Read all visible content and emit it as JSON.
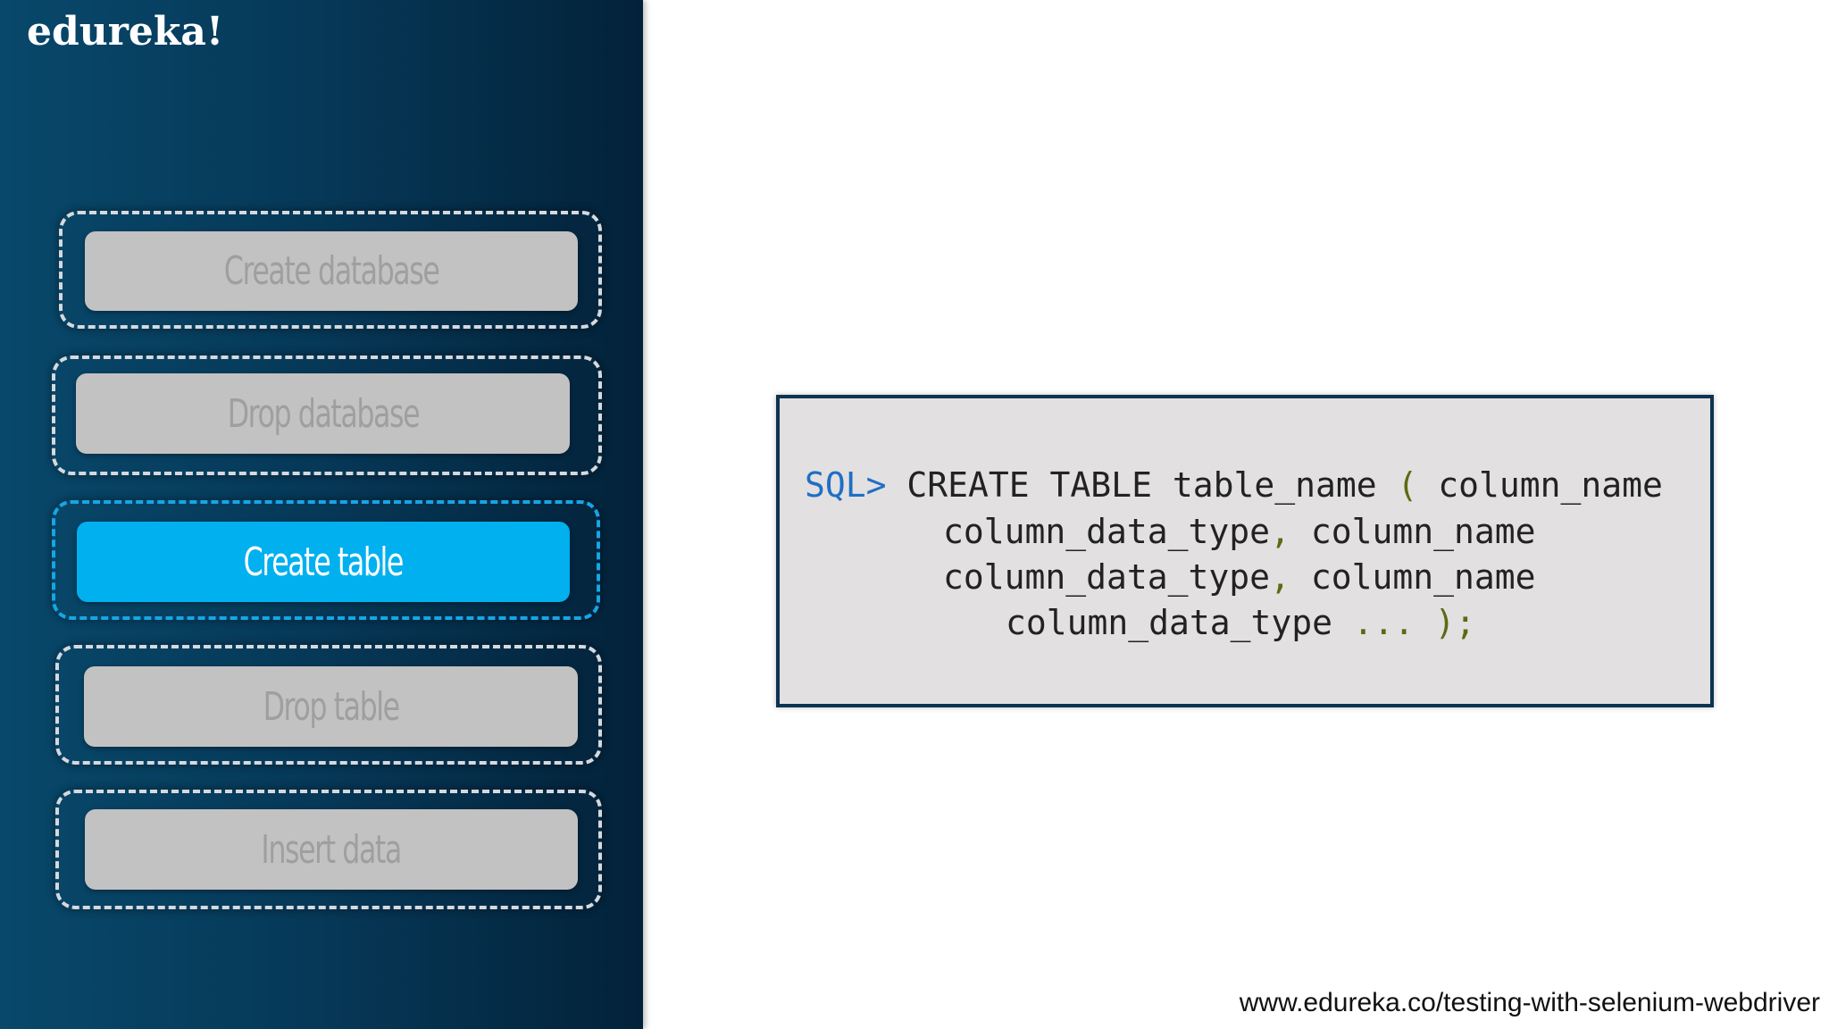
{
  "brand": {
    "logo_text": "edureka!"
  },
  "menu": {
    "items": [
      {
        "label": "Create database",
        "active": false
      },
      {
        "label": "Drop database",
        "active": false
      },
      {
        "label": "Create table",
        "active": true
      },
      {
        "label": "Drop table",
        "active": false
      },
      {
        "label": "Insert data",
        "active": false
      }
    ]
  },
  "code": {
    "prompt": "SQL>",
    "line1_main": "CREATE TABLE table_name",
    "line1_paren": "(",
    "line1_tail": "column_name",
    "line2_a": "column_data_type",
    "line2_comma": ",",
    "line2_b": "column_name",
    "line3_a": "column_data_type",
    "line3_comma": ",",
    "line3_b": "column_name",
    "line4_a": "column_data_type",
    "line4_ellipsis": "...",
    "line4_end": ");"
  },
  "footer": {
    "url": "www.edureka.co/testing-with-selenium-webdriver"
  },
  "colors": {
    "sidebar": "#063857",
    "active_button": "#00b0ef",
    "inactive_button": "#c2c2c2",
    "code_background": "#e2e0e1",
    "prompt": "#1f6fc4",
    "punctuation": "#5d6a12"
  }
}
